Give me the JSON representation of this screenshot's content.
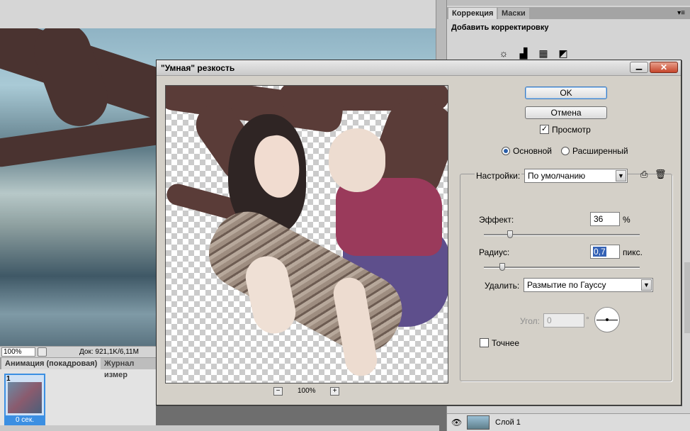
{
  "workspace": {
    "zoom": "100%",
    "doc_info": "Док: 921,1K/6,11M",
    "anim_tab": "Анимация (покадровая)",
    "history_tab": "Журнал измер",
    "frame_number": "1",
    "frame_time": "0 сек.",
    "tab_correction": "Коррекция",
    "tab_masks": "Маски",
    "add_adjustment": "Добавить корректировку",
    "layer_name": "Слой 1"
  },
  "dialog": {
    "title": "\"Умная\" резкость",
    "minimize": "▁",
    "close": "✕",
    "ok": "OK",
    "cancel": "Отмена",
    "preview_checkbox": "Просмотр",
    "preview_checked": true,
    "mode_basic": "Основной",
    "mode_advanced": "Расширенный",
    "mode_selected": "Основной",
    "settings_label": "Настройки:",
    "settings_value": "По умолчанию",
    "amount_label": "Эффект:",
    "amount_value": "36",
    "amount_unit": "%",
    "amount_slider_fraction": 0.15,
    "radius_label": "Радиус:",
    "radius_value": "0,7",
    "radius_unit": "пикс.",
    "radius_slider_fraction": 0.1,
    "remove_label": "Удалить:",
    "remove_value": "Размытие по Гауссу",
    "angle_label": "Угол:",
    "angle_value": "0",
    "angle_unit": "°",
    "more_accurate": "Точнее",
    "preview_zoom": "100%",
    "zoom_out": "−",
    "zoom_in": "+"
  }
}
